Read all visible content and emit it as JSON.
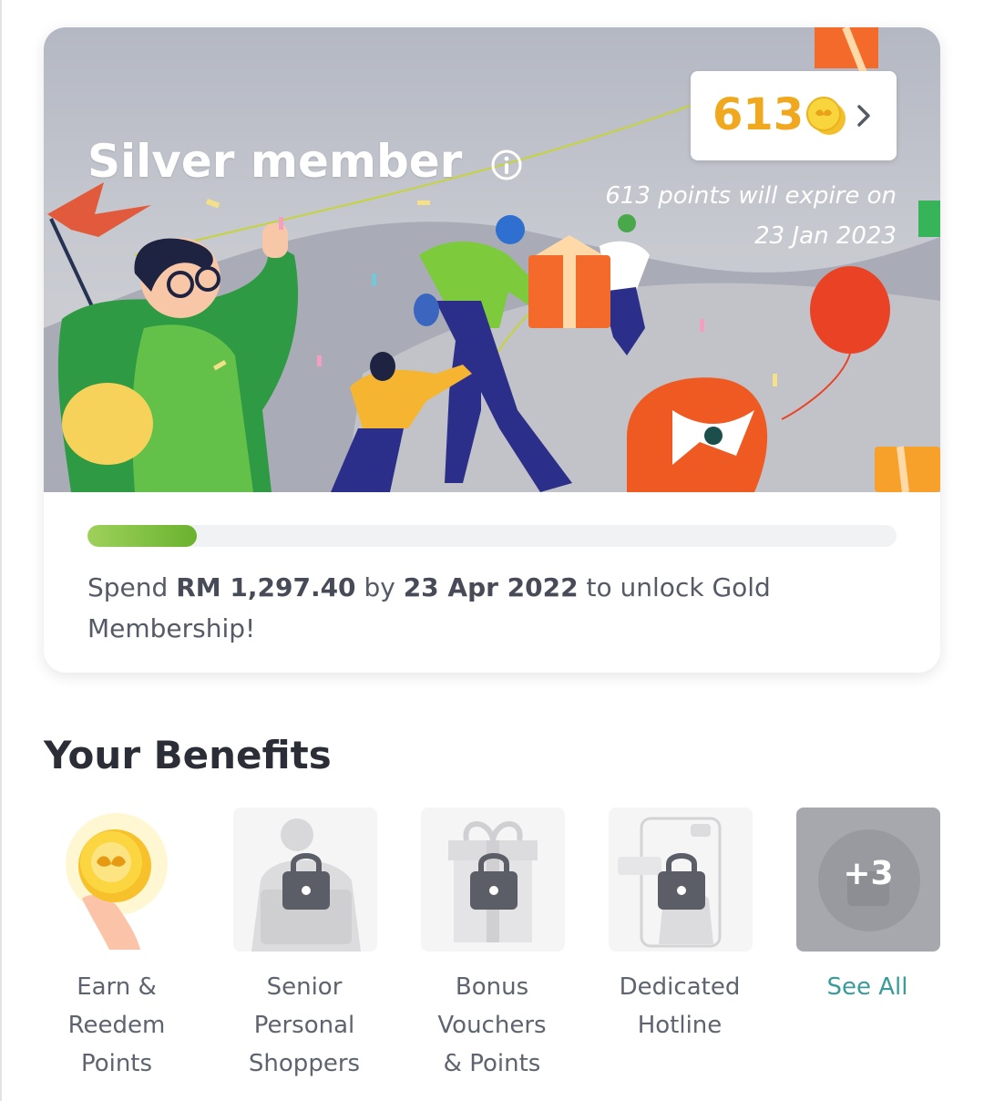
{
  "membership": {
    "tier_title": "Silver member",
    "points": "613",
    "expire_line1": "613 points will expire on",
    "expire_line2": "23 Jan 2023",
    "progress": 0.135,
    "unlock": {
      "prefix": "Spend ",
      "amount": "RM 1,297.40",
      "by": " by ",
      "date": "23 Apr 2022",
      "suffix": " to unlock Gold Membership!"
    }
  },
  "benefits": {
    "title": "Your Benefits",
    "items": [
      {
        "line1": "Earn &",
        "line2": "Reedem",
        "line3": "Points",
        "icon": "coin-hand-icon",
        "locked": false
      },
      {
        "line1": "Senior",
        "line2": "Personal",
        "line3": "Shoppers",
        "icon": "lock-icon",
        "locked": true
      },
      {
        "line1": "Bonus",
        "line2": "Vouchers",
        "line3": "& Points",
        "icon": "lock-icon",
        "locked": true
      },
      {
        "line1": "Dedicated",
        "line2": "Hotline",
        "line3": "",
        "icon": "lock-icon",
        "locked": true
      }
    ],
    "more_count": "+3",
    "see_all": "See All"
  },
  "colors": {
    "points_gold": "#f0a81f",
    "progress_green": "#7fc23f",
    "link_teal": "#3a9b98",
    "text_dark": "#2b2e36"
  }
}
